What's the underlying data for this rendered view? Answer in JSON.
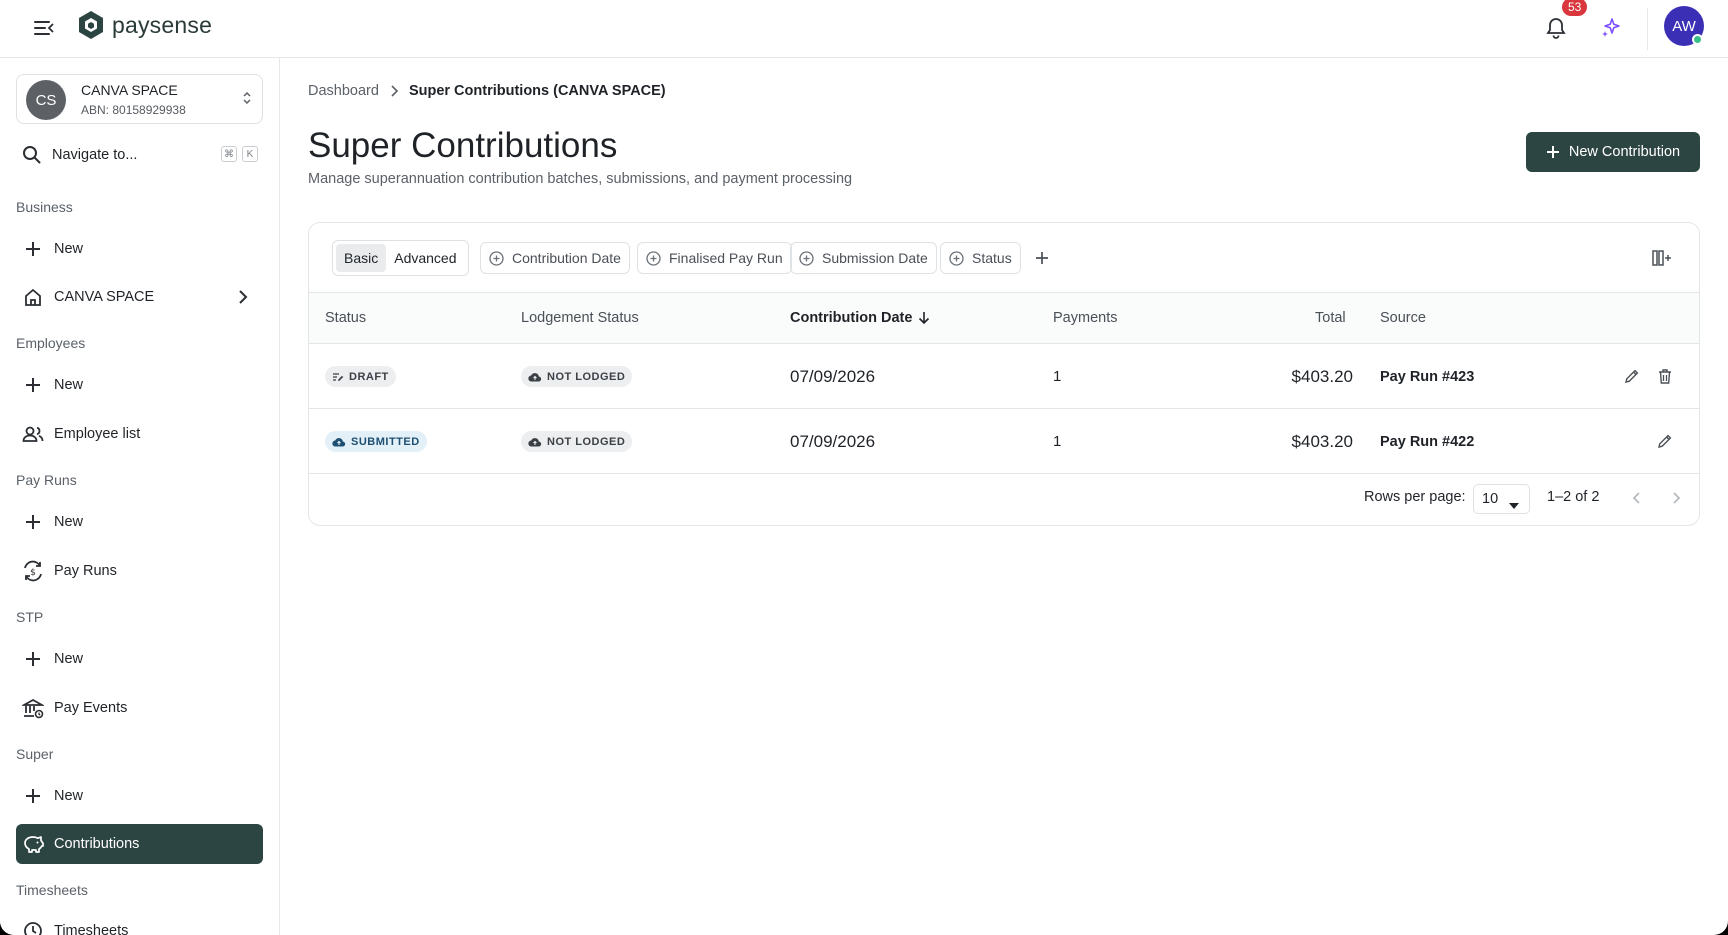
{
  "app": {
    "brand": "paysense",
    "notifications_count": "53",
    "user_initials": "AW",
    "colors": {
      "primary": "#2d4542",
      "avatar": "#3b2fb5",
      "badge": "#d9363e",
      "online": "#3bbf8a",
      "sparkle": "#7c4dff"
    }
  },
  "org": {
    "initials": "CS",
    "name": "CANVA SPACE",
    "abn": "ABN: 80158929938"
  },
  "nav": {
    "search_label": "Navigate to...",
    "kbd1": "⌘",
    "kbd2": "K",
    "sections": {
      "business": "Business",
      "employees": "Employees",
      "pay_runs": "Pay Runs",
      "stp": "STP",
      "super": "Super",
      "timesheets": "Timesheets"
    },
    "items": {
      "business_new": "New",
      "canva_space": "CANVA SPACE",
      "employees_new": "New",
      "employee_list": "Employee list",
      "pay_runs_new": "New",
      "pay_runs": "Pay Runs",
      "stp_new": "New",
      "pay_events": "Pay Events",
      "super_new": "New",
      "contributions": "Contributions",
      "timesheets": "Timesheets"
    }
  },
  "breadcrumb": {
    "root": "Dashboard",
    "current": "Super Contributions (CANVA SPACE)"
  },
  "page": {
    "title": "Super Contributions",
    "subtitle": "Manage superannuation contribution batches, submissions, and payment processing",
    "new_button": "New Contribution"
  },
  "filters": {
    "basic": "Basic",
    "advanced": "Advanced",
    "chips": {
      "contribution_date": "Contribution Date",
      "finalised_pay_run": "Finalised Pay Run",
      "submission_date": "Submission Date",
      "status": "Status"
    }
  },
  "table": {
    "columns": {
      "status": "Status",
      "lodgement": "Lodgement Status",
      "date": "Contribution Date",
      "payments": "Payments",
      "total": "Total",
      "source": "Source"
    },
    "rows": [
      {
        "status": "DRAFT",
        "lodgement": "NOT LODGED",
        "date": "07/09/2026",
        "payments": "1",
        "total": "$403.20",
        "source": "Pay Run #423"
      },
      {
        "status": "SUBMITTED",
        "lodgement": "NOT LODGED",
        "date": "07/09/2026",
        "payments": "1",
        "total": "$403.20",
        "source": "Pay Run #422"
      }
    ]
  },
  "pagination": {
    "rows_per_page_label": "Rows per page:",
    "rows_per_page": "10",
    "range": "1–2 of 2"
  }
}
